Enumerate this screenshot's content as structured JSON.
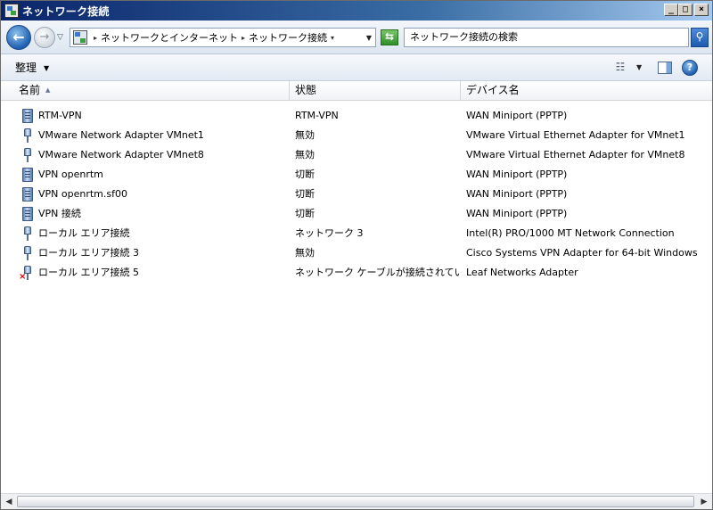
{
  "window": {
    "title": "ネットワーク接続",
    "minimize_label": "_",
    "maximize_label": "□",
    "close_label": "×"
  },
  "nav": {
    "back_glyph": "←",
    "forward_glyph": "→",
    "recent_glyph": "▽",
    "breadcrumbs": [
      "ネットワークとインターネット",
      "ネットワーク接続"
    ],
    "crumb_sep": "▸",
    "crumb_tail": "▾",
    "address_dropdown": "▼",
    "refresh_glyph": "⇆",
    "search_value": "ネットワーク接続の検索",
    "search_glyph": "⚲"
  },
  "toolbar": {
    "organize_label": "整理",
    "organize_arrow": "▼",
    "view_glyph": "☷",
    "view_drop": "▼",
    "help_glyph": "?"
  },
  "columns": {
    "name": "名前",
    "state": "状態",
    "device": "デバイス名",
    "sort_glyph": "▲"
  },
  "connections": [
    {
      "name": "RTM-VPN",
      "state": "RTM-VPN",
      "device": "WAN Miniport (PPTP)",
      "icon": "vpn-icon",
      "disconnected": false
    },
    {
      "name": "VMware Network Adapter VMnet1",
      "state": "無効",
      "device": "VMware Virtual Ethernet Adapter for VMnet1",
      "icon": "lan-icon",
      "disconnected": false
    },
    {
      "name": "VMware Network Adapter VMnet8",
      "state": "無効",
      "device": "VMware Virtual Ethernet Adapter for VMnet8",
      "icon": "lan-icon",
      "disconnected": false
    },
    {
      "name": "VPN openrtm",
      "state": "切断",
      "device": "WAN Miniport (PPTP)",
      "icon": "vpn-icon",
      "disconnected": false
    },
    {
      "name": "VPN openrtm.sf00",
      "state": "切断",
      "device": "WAN Miniport (PPTP)",
      "icon": "vpn-icon",
      "disconnected": false
    },
    {
      "name": "VPN 接続",
      "state": "切断",
      "device": "WAN Miniport (PPTP)",
      "icon": "vpn-icon",
      "disconnected": false
    },
    {
      "name": "ローカル エリア接続",
      "state": "ネットワーク 3",
      "device": "Intel(R) PRO/1000 MT Network Connection",
      "icon": "lan-icon",
      "disconnected": false
    },
    {
      "name": "ローカル エリア接続 3",
      "state": "無効",
      "device": "Cisco Systems VPN Adapter for 64-bit Windows",
      "icon": "lan-icon",
      "disconnected": false
    },
    {
      "name": "ローカル エリア接続 5",
      "state": "ネットワーク ケーブルが接続されてい...",
      "device": "Leaf Networks Adapter",
      "icon": "lan-icon",
      "disconnected": true
    }
  ],
  "scrollbar": {
    "left_glyph": "◀",
    "right_glyph": "▶"
  }
}
